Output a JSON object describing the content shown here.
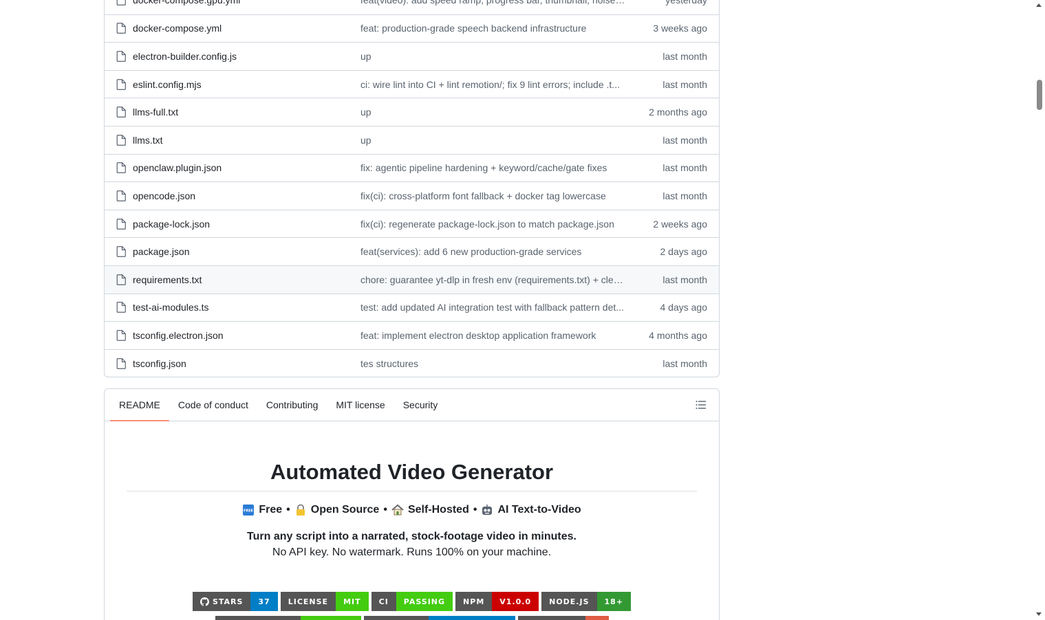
{
  "files": [
    {
      "name": "docker-compose.gpu.yml",
      "message": "feat(video): add speed ramp, progress bar, thumbnail, noise r...",
      "date": "yesterday"
    },
    {
      "name": "docker-compose.yml",
      "message": "feat: production-grade speech backend infrastructure",
      "date": "3 weeks ago"
    },
    {
      "name": "electron-builder.config.js",
      "message": "up",
      "date": "last month"
    },
    {
      "name": "eslint.config.mjs",
      "message": "ci: wire lint into CI + lint remotion/; fix 9 lint errors; include .t...",
      "date": "last month"
    },
    {
      "name": "llms-full.txt",
      "message": "up",
      "date": "2 months ago"
    },
    {
      "name": "llms.txt",
      "message": "up",
      "date": "last month"
    },
    {
      "name": "openclaw.plugin.json",
      "message": "fix: agentic pipeline hardening + keyword/cache/gate fixes",
      "date": "last month"
    },
    {
      "name": "opencode.json",
      "message": "fix(ci): cross-platform font fallback + docker tag lowercase",
      "date": "last month"
    },
    {
      "name": "package-lock.json",
      "message": "fix(ci): regenerate package-lock.json to match package.json",
      "date": "2 weeks ago"
    },
    {
      "name": "package.json",
      "message": "feat(services): add 6 new production-grade services",
      "date": "2 days ago"
    },
    {
      "name": "requirements.txt",
      "message": "chore: guarantee yt-dlp in fresh env (requirements.txt) + clea...",
      "date": "last month"
    },
    {
      "name": "test-ai-modules.ts",
      "message": "test: add updated AI integration test with fallback pattern det...",
      "date": "4 days ago"
    },
    {
      "name": "tsconfig.electron.json",
      "message": "feat: implement electron desktop application framework",
      "date": "4 months ago"
    },
    {
      "name": "tsconfig.json",
      "message": "tes structures",
      "date": "last month"
    }
  ],
  "readme": {
    "tabs": [
      "README",
      "Code of conduct",
      "Contributing",
      "MIT license",
      "Security"
    ],
    "active_tab": "README",
    "title": "Automated Video Generator",
    "features": [
      {
        "icon": "free-icon",
        "label": "Free"
      },
      {
        "icon": "lock-icon",
        "label": "Open Source"
      },
      {
        "icon": "house-icon",
        "label": "Self-Hosted"
      },
      {
        "icon": "robot-icon",
        "label": "AI Text-to-Video"
      }
    ],
    "separator": "•",
    "tagline": "Turn any script into a narrated, stock-footage video in minutes.",
    "subline": "No API key. No watermark. Runs 100% on your machine.",
    "badges": [
      {
        "label": "STARS",
        "value": "37",
        "color": "#007ec6",
        "icon": "github-icon"
      },
      {
        "label": "LICENSE",
        "value": "MIT",
        "color": "#4c1"
      },
      {
        "label": "CI",
        "value": "PASSING",
        "color": "#4c1"
      },
      {
        "label": "NPM",
        "value": "V1.0.0",
        "color": "#cb0000"
      },
      {
        "label": "NODE.JS",
        "value": "18+",
        "color": "#339933"
      }
    ]
  },
  "colors": {
    "border": "#d0d7de",
    "muted_text": "#59636e",
    "active_tab_underline": "#fd8c73",
    "hover_row": "#f6f8fa"
  }
}
